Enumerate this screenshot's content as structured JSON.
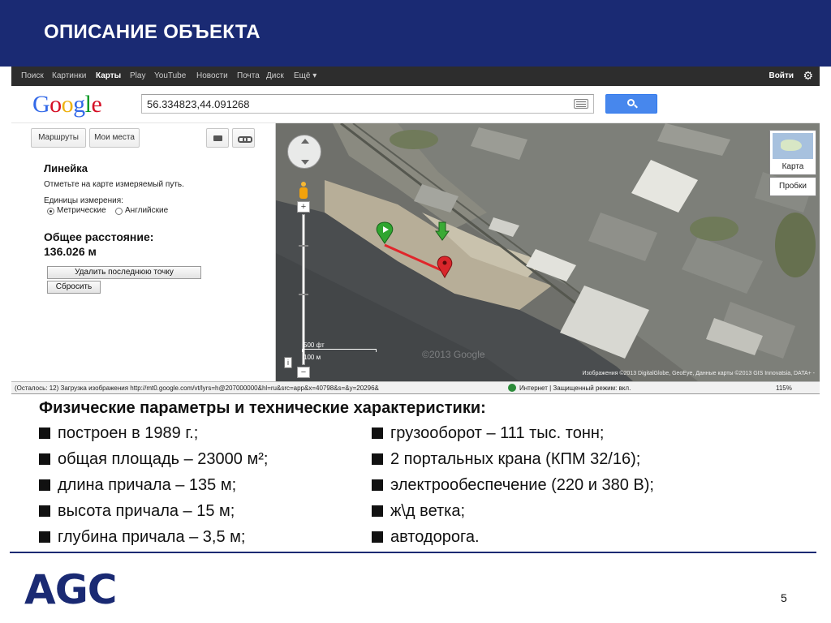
{
  "slide": {
    "title": "ОПИСАНИЕ ОБЪЕКТА",
    "page_number": "5",
    "logo_text": "AGC"
  },
  "gbar": {
    "items": [
      "Поиск",
      "Картинки",
      "Карты",
      "Play",
      "YouTube",
      "Новости",
      "Почта",
      "Диск",
      "Ещё ▾"
    ],
    "active": "Карты",
    "login": "Войти"
  },
  "search": {
    "value": "56.334823,44.091268"
  },
  "left_panel": {
    "btn_routes": "Маршруты",
    "btn_myplaces": "Мои места",
    "ruler_title": "Линейка",
    "ruler_hint": "Отметьте на карте измеряемый путь.",
    "units_label": "Единицы измерения:",
    "opt_metric": "Метрические",
    "opt_english": "Английские",
    "selected_unit": "Метрические",
    "dist_label": "Общее расстояние:",
    "dist_value": "136.026 м",
    "btn_remove_point": "Удалить последнюю точку",
    "btn_reset": "Сбросить"
  },
  "map": {
    "map_type": "Карта",
    "traffic": "Пробки",
    "scale_ft": "500 фт",
    "scale_m": "100 м",
    "attribution": "Изображения ©2013 DigitalGlobe, GeoEye, Данные карты ©2013 GIS Innovatsia, DATA+ -",
    "watermark": "©2013 Google",
    "info": "i"
  },
  "statusbar": {
    "text": "(Осталось: 12) Загрузка изображения http://mt0.google.com/vt/lyrs=h@207000000&hl=ru&src=app&x=40798&s=&y=20296&",
    "zone": "Интернет | Защищенный режим: вкл.",
    "zoom": "115%"
  },
  "body": {
    "title": "Физические параметры и технические характеристики:",
    "left_items": [
      "построен в 1989 г.;",
      "общая площадь – 23000 м²;",
      "длина причала – 135 м;",
      "высота причала  – 15 м;",
      "глубина причала – 3,5 м;"
    ],
    "right_items": [
      "грузооборот – 111 тыс. тонн;",
      "2 портальных крана (КПМ 32/16);",
      "электрообеспечение (220 и 380 В);",
      "ж\\д ветка;",
      "автодорога."
    ]
  },
  "colors": {
    "brand_navy": "#1a2a73",
    "google_blue": "#4787ed",
    "marker_green": "#2fa52f",
    "marker_red": "#d9262b",
    "measure_line": "#e0262b"
  }
}
